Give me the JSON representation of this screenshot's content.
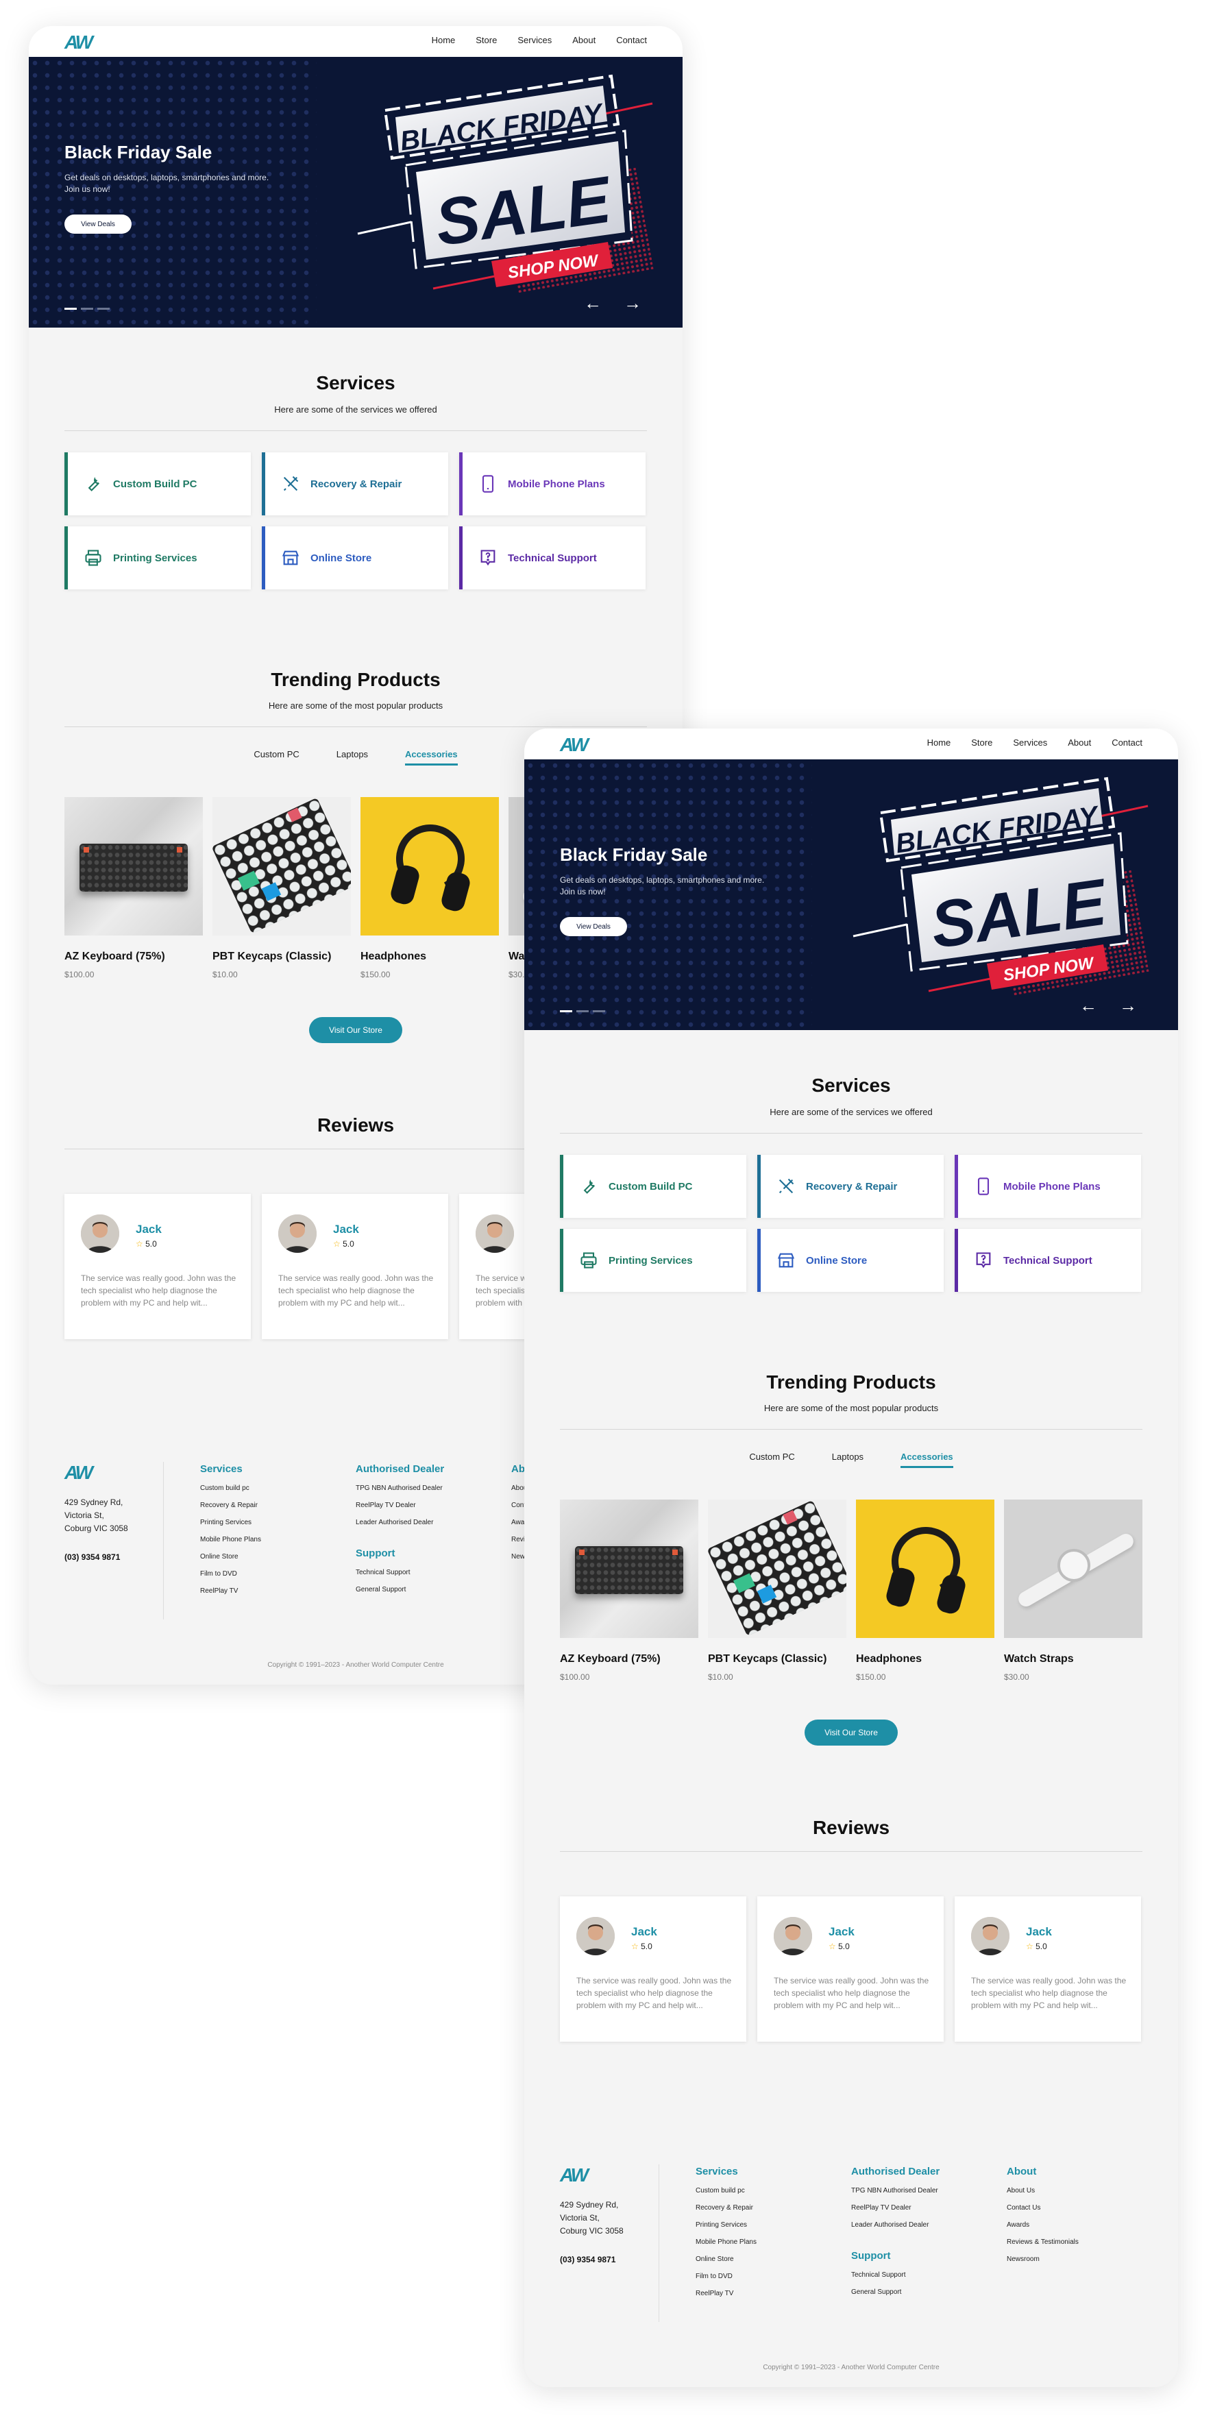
{
  "nav": {
    "logo": "AW",
    "links": [
      "Home",
      "Store",
      "Services",
      "About",
      "Contact"
    ]
  },
  "hero": {
    "title": "Black Friday Sale",
    "subtitle": "Get deals on desktops, laptops, smartphones and more. Join us now!",
    "button": "View Deals",
    "banner_line1": "BLACK FRIDAY",
    "banner_line2": "SALE",
    "banner_cta": "SHOP NOW"
  },
  "services": {
    "title": "Services",
    "subtitle": "Here are some of the services we offered",
    "items": [
      {
        "label": "Custom Build PC",
        "icon": "wrench-icon",
        "color": "#1f7a64"
      },
      {
        "label": "Recovery & Repair",
        "icon": "tools-icon",
        "color": "#1e6f95"
      },
      {
        "label": "Mobile Phone Plans",
        "icon": "phone-icon",
        "color": "#6a37b8"
      },
      {
        "label": "Printing Services",
        "icon": "printer-icon",
        "color": "#1f7a64"
      },
      {
        "label": "Online Store",
        "icon": "store-icon",
        "color": "#2d5cc0"
      },
      {
        "label": "Technical Support",
        "icon": "help-icon",
        "color": "#5b2aa5"
      }
    ]
  },
  "trending": {
    "title": "Trending Products",
    "subtitle": "Here are some of the most popular products",
    "tabs": [
      "Custom PC",
      "Laptops",
      "Accessories"
    ],
    "active_tab": "Accessories",
    "products": [
      {
        "name": "AZ Keyboard (75%)",
        "price": "$100.00"
      },
      {
        "name": "PBT Keycaps (Classic)",
        "price": "$10.00"
      },
      {
        "name": "Headphones",
        "price": "$150.00"
      },
      {
        "name": "Watch Straps",
        "price": "$30.00"
      }
    ],
    "button": "Visit Our Store"
  },
  "reviews": {
    "title": "Reviews",
    "items": [
      {
        "name": "Jack",
        "rating": "5.0",
        "text": "The service was really good. John was the tech specialist who help diagnose the problem with my PC and help wit..."
      },
      {
        "name": "Jack",
        "rating": "5.0",
        "text": "The service was really good. John was the tech specialist who help diagnose the problem with my PC and help wit..."
      },
      {
        "name": "Jack",
        "rating": "5.0",
        "text": "The service was really good. John was the tech specialist who help diagnose the problem with my PC and help wit..."
      }
    ]
  },
  "footer": {
    "address_line1": "429 Sydney Rd,",
    "address_line2": "Victoria St,",
    "address_line3": "Coburg VIC 3058",
    "phone": "(03) 9354 9871",
    "services_title": "Services",
    "services_links": [
      "Custom build pc",
      "Recovery & Repair",
      "Printing Services",
      "Mobile Phone Plans",
      "Online Store",
      "Film to DVD",
      "ReelPlay TV"
    ],
    "dealer_title": "Authorised Dealer",
    "dealer_links": [
      "TPG NBN Authorised Dealer",
      "ReelPlay TV Dealer",
      "Leader Authorised Dealer"
    ],
    "support_title": "Support",
    "support_links": [
      "Technical Support",
      "General Support"
    ],
    "about_title": "About",
    "about_links": [
      "About Us",
      "Contact Us",
      "Awards",
      "Reviews & Testimonials",
      "Newsroom"
    ],
    "copyright": "Copyright © 1991–2023 - Another World Computer Centre"
  }
}
